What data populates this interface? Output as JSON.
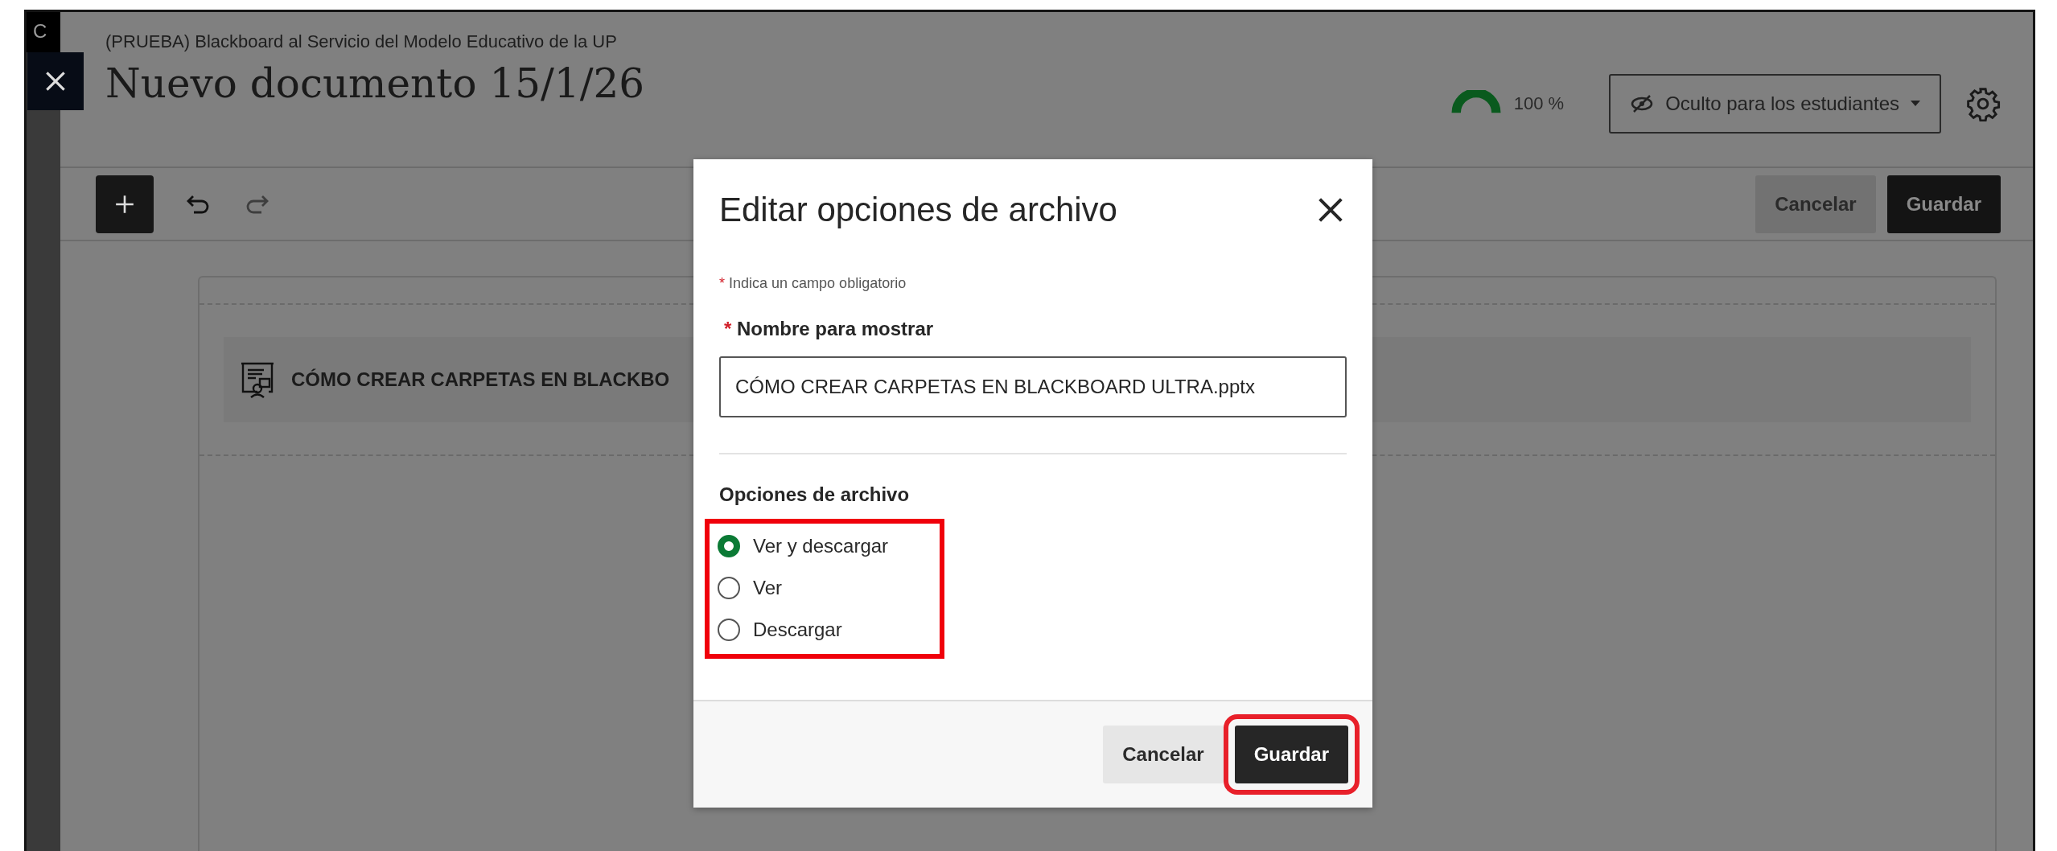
{
  "edge_text": "C",
  "course_title": "(PRUEBA) Blackboard al Servicio del Modelo Educativo de la UP",
  "page_title": "Nuevo documento 15/1/26",
  "progress": {
    "reading": "100 %"
  },
  "visibility": {
    "label": "Oculto para los estudiantes"
  },
  "toolbar": {
    "buttons": [
      {
        "label": "Cancelar",
        "kind": "secondary"
      },
      {
        "label": "Guardar",
        "kind": "primary"
      }
    ]
  },
  "content_item": {
    "title": "CÓMO CREAR CARPETAS EN BLACKBO"
  },
  "dialog": {
    "title": "Editar opciones de archivo",
    "required_note": {
      "mark": "*",
      "text": "Indica un campo obligatorio"
    },
    "field": {
      "mark": "*",
      "label": "Nombre para mostrar",
      "value": "CÓMO CREAR CARPETAS EN BLACKBOARD ULTRA.pptx"
    },
    "options_label": "Opciones de archivo",
    "options_annotated": true,
    "options": [
      {
        "label": "Ver y descargar",
        "selected": true
      },
      {
        "label": "Ver",
        "selected": false
      },
      {
        "label": "Descargar",
        "selected": false
      }
    ],
    "buttons": [
      {
        "label": "Cancelar",
        "kind": "secondary",
        "annotated": false
      },
      {
        "label": "Guardar",
        "kind": "primary",
        "annotated": true
      }
    ]
  }
}
